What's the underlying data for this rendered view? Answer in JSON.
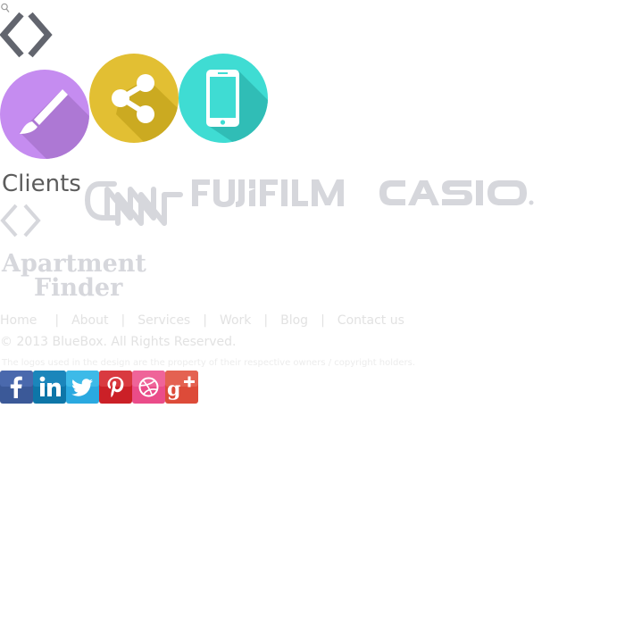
{
  "header": {
    "search_icon": "search-icon",
    "diamond_icon": "diamond-arrows-icon"
  },
  "services": {
    "items": [
      {
        "icon": "paintbrush-icon",
        "color": "#c58cf0"
      },
      {
        "icon": "share-icon",
        "color": "#e2bf33"
      },
      {
        "icon": "smartphone-icon",
        "color": "#3fdcd3"
      }
    ]
  },
  "clients": {
    "heading": "Clients",
    "logos": [
      {
        "name": "CNN"
      },
      {
        "name": "FUJIFILM"
      },
      {
        "name": "CASIO"
      },
      {
        "name": "Apartment Finder"
      }
    ]
  },
  "footer": {
    "nav": {
      "home": "Home",
      "about": "About",
      "services": "Services",
      "work": "Work",
      "blog": "Blog",
      "contact": "Contact us",
      "separator": "|"
    },
    "copyright": "© 2013 BlueBox.  All Rights Reserved.",
    "disclaimer": "The logos used in the design are the property of their respective owners / copyright holders."
  },
  "social": {
    "items": [
      {
        "icon": "facebook-icon",
        "color": "#3b5998"
      },
      {
        "icon": "linkedin-icon",
        "color": "#0e76a8"
      },
      {
        "icon": "twitter-icon",
        "color": "#2aa9e0"
      },
      {
        "icon": "pinterest-icon",
        "color": "#cb2027"
      },
      {
        "icon": "dribbble-icon",
        "color": "#ea4c89"
      },
      {
        "icon": "google-plus-icon",
        "color": "#dd4b39"
      }
    ]
  }
}
